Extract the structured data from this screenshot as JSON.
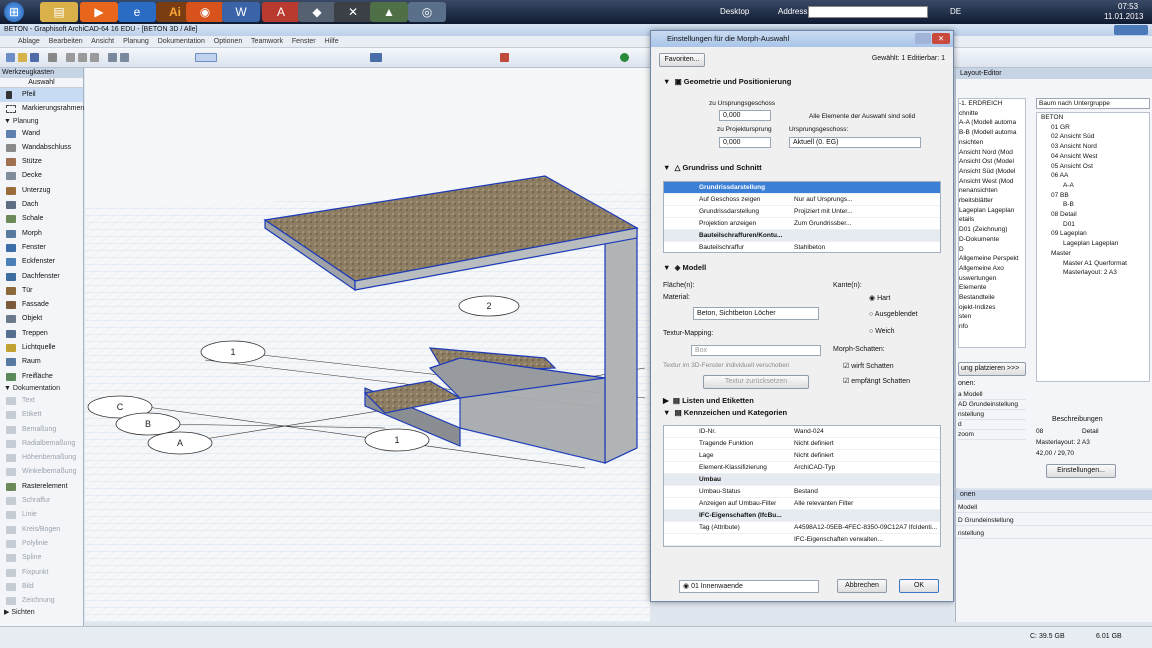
{
  "taskbar": {
    "desktop_label": "Desktop",
    "address_label": "Address",
    "lang": "DE",
    "time": "07:53",
    "date": "11.01.2013"
  },
  "app": {
    "title": "BETON - Graphisoft ArchiCAD-64 16 EDU - [BETON 3D / Alle]",
    "menu": [
      "Ablage",
      "Bearbeiten",
      "Ansicht",
      "Planung",
      "Dokumentation",
      "Optionen",
      "Teamwork",
      "Fenster",
      "Hilfe"
    ]
  },
  "toolbox": {
    "title": "Werkzeugkasten",
    "subtitle": "Auswahl",
    "select_tools": [
      "Pfeil",
      "Markierungsrahmen"
    ],
    "planning_label": "Planung",
    "planning": [
      "Wand",
      "Wandabschluss",
      "Stütze",
      "Decke",
      "Unterzug",
      "Dach",
      "Schale",
      "Morph",
      "Fenster",
      "Eckfenster",
      "Dachfenster",
      "Tür",
      "Fassade",
      "Objekt",
      "Treppen",
      "Lichtquelle",
      "Raum",
      "Freifläche"
    ],
    "documentation_label": "Dokumentation",
    "documentation": [
      "Text",
      "Etikett",
      "Bemaßung",
      "Radialbemaßung",
      "Höhenbemaßung",
      "Winkelbemaßung",
      "Rasterelement",
      "Schraffur",
      "Linie",
      "Kreis/Bogen",
      "Polylinie",
      "Spline",
      "Fixpunkt",
      "Bild",
      "Zeichnung"
    ],
    "views_label": "Sichten"
  },
  "dialog": {
    "title": "Einstellungen für die Morph-Auswahl",
    "favorites": "Favoriten...",
    "selected": "Gewählt: 1 Editierbar: 1",
    "geo_section": "Geometrie und Positionierung",
    "to_story_label": "zu Ursprungsgeschoss",
    "to_story_value": "0,000",
    "to_proj_label": "zu Projektursprung",
    "to_proj_value": "0,000",
    "solid_note": "Alle Elemente der Auswahl sind solid",
    "home_story_label": "Ursprungsgeschoss:",
    "home_story_value": "Aktuell (0. EG)",
    "floorplan_section": "Grundriss und Schnitt",
    "floorplan_rows": [
      {
        "a": "Grundrissdarstellung",
        "b": "",
        "type": "sel"
      },
      {
        "a": "Auf Geschoss zeigen",
        "b": "Nur auf Ursprungs..."
      },
      {
        "a": "Grundrissdarstellung",
        "b": "Projiziert mit Unter..."
      },
      {
        "a": "Projektion anzeigen",
        "b": "Zum Grundrissber..."
      },
      {
        "a": "Bauteilschraffuren/Kontu...",
        "b": "",
        "type": "hdr"
      },
      {
        "a": "Bauteilschraffur",
        "b": "Stahlbeton"
      }
    ],
    "model_section": "Modell",
    "surface_label": "Fläche(n):",
    "material_label": "Material:",
    "material_value": "Beton, Sichtbeton Löcher",
    "texture_label": "Textur-Mapping:",
    "texture_value": "Box",
    "texture_note": "Textur im 3D-Fenster individuell verschoben",
    "texture_reset": "Textur zurücksetzen",
    "edges_label": "Kante(n):",
    "edge_options": [
      "Hart",
      "Ausgeblendet",
      "Weich"
    ],
    "shadows_label": "Morph-Schatten:",
    "cast_shadows": "wirft Schatten",
    "receive_shadows": "empfängt Schatten",
    "lists_section": "Listen und Etiketten",
    "ids_section": "Kennzeichen und Kategorien",
    "id_rows": [
      {
        "a": "ID-Nr.",
        "b": "Wand-024"
      },
      {
        "a": "Tragende Funktion",
        "b": "Nicht definiert"
      },
      {
        "a": "Lage",
        "b": "Nicht definiert"
      },
      {
        "a": "Element-Klassifizierung",
        "b": "ArchiCAD-Typ"
      },
      {
        "a": "Umbau",
        "b": "",
        "type": "hdr"
      },
      {
        "a": "Umbau-Status",
        "b": "Bestand"
      },
      {
        "a": "Anzeigen auf Umbau-Filter",
        "b": "Alle relevanten Filter"
      },
      {
        "a": "IFC-Eigenschaften (IfcBu...",
        "b": "",
        "type": "hdr"
      },
      {
        "a": "Tag (Attribute)",
        "b": "A4598A12-05EB-4FEC-8350-09C12A7 IfcIdenti..."
      },
      {
        "a": "",
        "b": "IFC-Eigenschaften verwalten..."
      }
    ],
    "layer_value": "01 Innenwaende",
    "cancel": "Abbrechen",
    "ok": "OK"
  },
  "viewport": {
    "grid_labels": [
      "1",
      "C",
      "B",
      "A",
      "1",
      "2"
    ]
  },
  "layout_editor": {
    "title": "Layout-Editor",
    "left_items": [
      "-1. ERDREICH",
      "chnitte",
      "A-A (Modell automa",
      "B-B (Modell automa",
      "nsichten",
      "Ansicht Nord (Mod",
      "Ansicht Ost (Model",
      "Ansicht Süd (Model",
      "Ansicht West (Mod",
      "nenansichten",
      "rbeitsblätter",
      "Lageplan Lageplan",
      "etails",
      "D01 (Zeichnung)",
      "D-Dokumente",
      "D",
      "Allgemeine Perspekt",
      "Allgemeine Axo",
      "uswertungen",
      "Elemente",
      "Bestandteile",
      "ojekt-Indizes",
      "sten",
      "nfo"
    ],
    "dropdown": "Baum nach Untergruppe",
    "tree": [
      "BETON",
      "01 GR",
      "02 Ansicht Süd",
      "03 Ansicht Nord",
      "04 Ansicht West",
      "05 Ansicht Ost",
      "06 AA",
      "A-A",
      "07 BB",
      "B-B",
      "08 Detail",
      "D01",
      "09 Lageplan",
      "Lageplan Lageplan",
      "Master",
      "Master A1 Querformat",
      "Masterlayout: 2 A3"
    ],
    "place_btn": "ung platzieren >>>",
    "options_label": "onen:",
    "desc_label": "Beschreibungen",
    "desc_rows": [
      {
        "a": "08",
        "b": "Detail"
      },
      {
        "a": "Masterlayout: 2 A3",
        "b": ""
      },
      {
        "a": "42,00 / 29,70",
        "b": ""
      }
    ],
    "settings_btn": "Einstellungen...",
    "menu_items": [
      "a Modell",
      "AD Grundeinstellung",
      "nstellung",
      "d",
      "zoom"
    ]
  },
  "right2": {
    "title": "onen",
    "items": [
      "Modell",
      "D Grundeinstellung",
      "nstellung"
    ]
  },
  "status": {
    "disk_c": "C: 39.5 GB",
    "disk_other": "6.01 GB"
  }
}
